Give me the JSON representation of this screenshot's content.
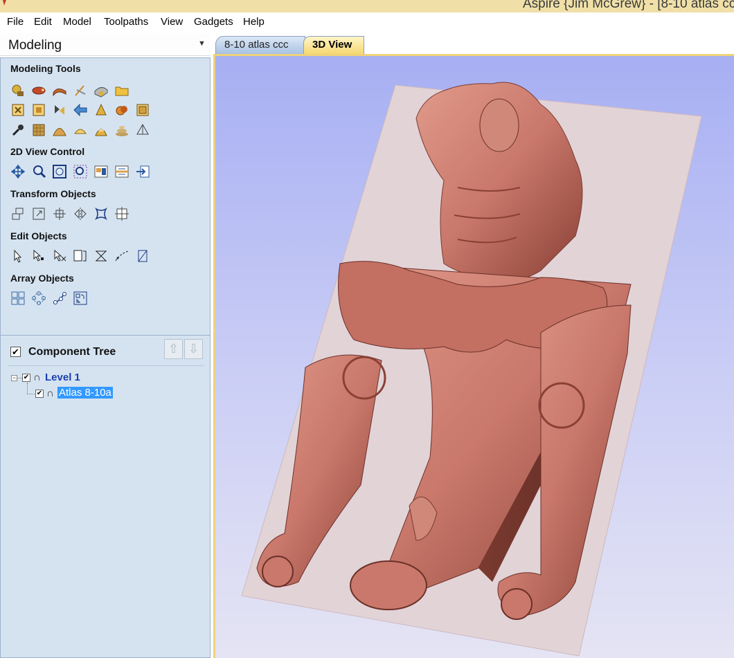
{
  "window": {
    "title": "Aspire {Jim McGrew} - [8-10 atlas cc"
  },
  "menu": {
    "items": [
      "File",
      "Edit",
      "Model",
      "Toolpaths",
      "View",
      "Gadgets",
      "Help"
    ]
  },
  "panel": {
    "title": "Modeling",
    "pin_icon": "pin-icon",
    "sections": {
      "modeling_tools": "Modeling Tools",
      "view_control": "2D View Control",
      "transform": "Transform Objects",
      "edit": "Edit Objects",
      "array": "Array Objects"
    }
  },
  "component_tree": {
    "title": "Component Tree",
    "up_arrow": "⇧",
    "down_arrow": "⇩",
    "level_label": "Level 1",
    "component_label": "Atlas 8-10a"
  },
  "tabs": {
    "doc": "8-10 atlas ccc",
    "view3d": "3D View"
  },
  "colors": {
    "panel_bg": "#d5e3f1",
    "tab_active": "#f5d872",
    "model": "#c9786b",
    "material": "#e0d2d6",
    "selection": "#3399ff"
  }
}
